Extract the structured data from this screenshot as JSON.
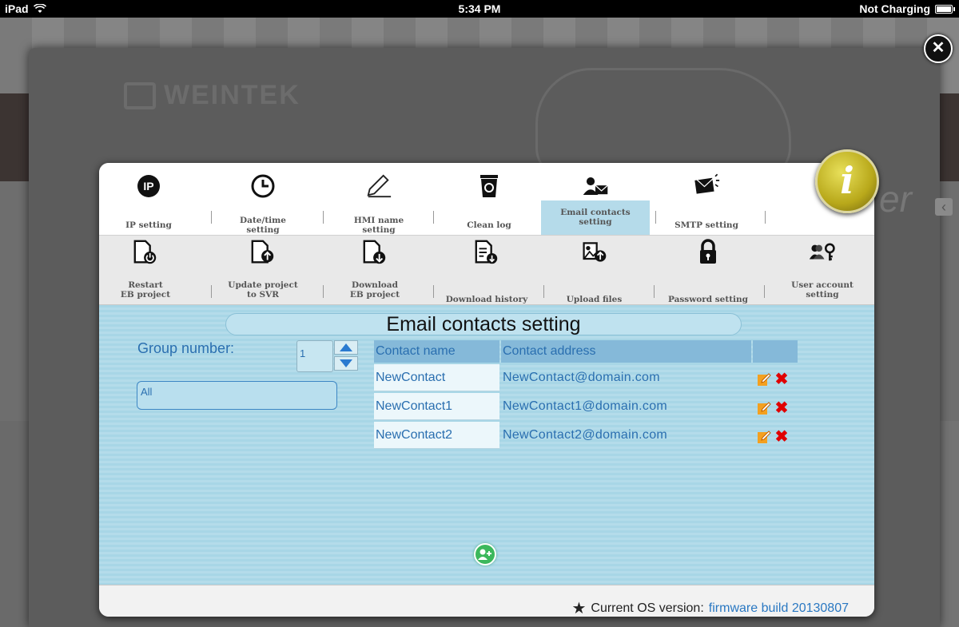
{
  "status_bar": {
    "device": "iPad",
    "time": "5:34 PM",
    "battery_text": "Not Charging"
  },
  "background": {
    "logo_text": "WEINTEK",
    "side_text": "er"
  },
  "toolbar_row1": [
    {
      "label": "IP setting",
      "icon": "ip-icon"
    },
    {
      "label": "Date/time\nsetting",
      "icon": "clock-icon"
    },
    {
      "label": "HMI name\nsetting",
      "icon": "pencil-icon"
    },
    {
      "label": "Clean log",
      "icon": "trash-icon"
    },
    {
      "label": "Email contacts\nsetting",
      "icon": "contact-mail-icon",
      "active": true
    },
    {
      "label": "SMTP setting",
      "icon": "mail-send-icon"
    }
  ],
  "toolbar_row2": [
    {
      "label": "Restart\nEB project",
      "icon": "doc-power-icon"
    },
    {
      "label": "Update project\nto SVR",
      "icon": "doc-upload-icon"
    },
    {
      "label": "Download\nEB project",
      "icon": "doc-download-icon"
    },
    {
      "label": "Download history",
      "icon": "doc-history-icon"
    },
    {
      "label": "Upload files",
      "icon": "image-upload-icon"
    },
    {
      "label": "Password setting",
      "icon": "lock-icon"
    },
    {
      "label": "User account\nsetting",
      "icon": "user-key-icon"
    }
  ],
  "panel": {
    "title": "Email contacts setting",
    "group_label": "Group number:",
    "group_value": "1",
    "list_value": "All"
  },
  "table": {
    "headers": [
      "Contact name",
      "Contact address"
    ],
    "rows": [
      {
        "name": "NewContact",
        "address": "NewContact@domain.com"
      },
      {
        "name": "NewContact1",
        "address": "NewContact1@domain.com"
      },
      {
        "name": "NewContact2",
        "address": "NewContact2@domain.com"
      }
    ]
  },
  "footer": {
    "label": "Current OS version:",
    "firmware": "firmware build 20130807"
  },
  "info_symbol": "i",
  "close_symbol": "✕",
  "colors": {
    "panel_bg": "#b4dcea",
    "header_bg": "#85b9d9",
    "link_blue": "#2a6fb0",
    "delete_red": "#e00000",
    "info_gold": "#b8a81a"
  }
}
